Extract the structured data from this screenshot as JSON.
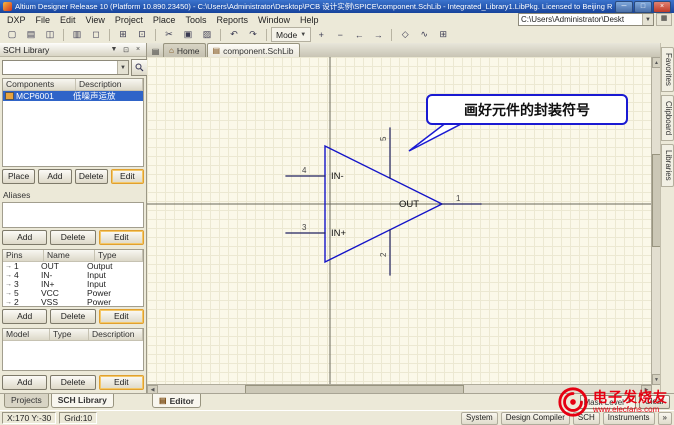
{
  "title_bar": {
    "title": "Altium Designer Release 10 (Platform 10.890.23450) - C:\\Users\\Administrator\\Desktop\\PCB 设计实例\\SPICE\\component.SchLib - Integrated_Library1.LibPkg. Licensed to Beijing Ruihe Huatai Tech Co Lt...",
    "minimize": "─",
    "maximize": "□",
    "close": "×"
  },
  "menu_bar": {
    "items": [
      "DXP",
      "File",
      "Edit",
      "View",
      "Project",
      "Place",
      "Tools",
      "Reports",
      "Window",
      "Help"
    ],
    "path_value": "C:\\Users\\Administrator\\Deskt",
    "dropdown_arrow": "▼",
    "side_button": "▦"
  },
  "toolbar": {
    "icons": [
      {
        "glyph": "▢"
      },
      {
        "glyph": "▤"
      },
      {
        "glyph": "◫"
      },
      {
        "glyph": "▥"
      },
      {
        "glyph": "◻"
      },
      {
        "glyph": "⊞"
      },
      {
        "glyph": "⊡"
      },
      {
        "glyph": "✂"
      },
      {
        "glyph": "▣"
      },
      {
        "glyph": "▨"
      },
      {
        "glyph": "↶"
      },
      {
        "glyph": "↷"
      }
    ],
    "mode_label": "Mode",
    "mode_arrow": "▼",
    "after_mode": [
      {
        "glyph": "+"
      },
      {
        "glyph": "−"
      },
      {
        "glyph": "←"
      },
      {
        "glyph": "→"
      },
      {
        "glyph": "◇"
      },
      {
        "glyph": "∿"
      },
      {
        "glyph": "⊞"
      }
    ]
  },
  "sch_library": {
    "panel_title": "SCH Library",
    "header_icons": {
      "dropdown": "▼",
      "pin": "⊡",
      "close": "×"
    },
    "components": {
      "col1": "Components",
      "col2": "Description",
      "rows": [
        {
          "name": "MCP6001",
          "description": "低噪声运放"
        }
      ],
      "buttons": [
        "Place",
        "Add",
        "Delete",
        "Edit"
      ]
    },
    "aliases": {
      "label": "Aliases",
      "buttons": [
        "Add",
        "Delete",
        "Edit"
      ]
    },
    "pins": {
      "col1": "Pins",
      "col2": "Name",
      "col3": "Type",
      "icon": "→",
      "rows": [
        {
          "num": "1",
          "name": "OUT",
          "type": "Output"
        },
        {
          "num": "4",
          "name": "IN-",
          "type": "Input"
        },
        {
          "num": "3",
          "name": "IN+",
          "type": "Input"
        },
        {
          "num": "5",
          "name": "VCC",
          "type": "Power"
        },
        {
          "num": "2",
          "name": "VSS",
          "type": "Power"
        }
      ],
      "buttons": [
        "Add",
        "Delete",
        "Edit"
      ]
    },
    "model": {
      "col1": "Model",
      "col2": "Type",
      "col3": "Description",
      "buttons": [
        "Add",
        "Delete",
        "Edit"
      ]
    },
    "bottom_tabs": [
      "Projects",
      "SCH Library"
    ]
  },
  "document_bar": {
    "menu_icon": "▤",
    "home_icon": "⌂",
    "home_tab": "Home",
    "doc_icon": "▤",
    "doc_tab": "component.SchLib"
  },
  "canvas": {
    "callout_text": "画好元件的封装符号",
    "symbol": {
      "pin4_num": "4",
      "pin4_name": "IN-",
      "pin3_num": "3",
      "pin3_name": "IN+",
      "pin1_num": "1",
      "pin1_name": "OUT",
      "pin5_num": "5",
      "pin2_num": "2"
    }
  },
  "scrollbars": {
    "up": "▲",
    "down": "▼",
    "left": "◀",
    "right": "▶"
  },
  "right_tabs": [
    "Favorites",
    "Clipboard",
    "Libraries"
  ],
  "bottom": {
    "editor_tab_icon": "▤",
    "editor_tab": "Editor",
    "mask_level": "Mask Level",
    "clear_button": "Clear",
    "coords": "X:170 Y:-30",
    "grid": "Grid:10",
    "panel_buttons": [
      "System",
      "Design Compiler",
      "SCH",
      "Instruments"
    ],
    "overflow": "»"
  },
  "watermark": {
    "name": "电子发烧友",
    "url": "www.elecfans.com"
  }
}
